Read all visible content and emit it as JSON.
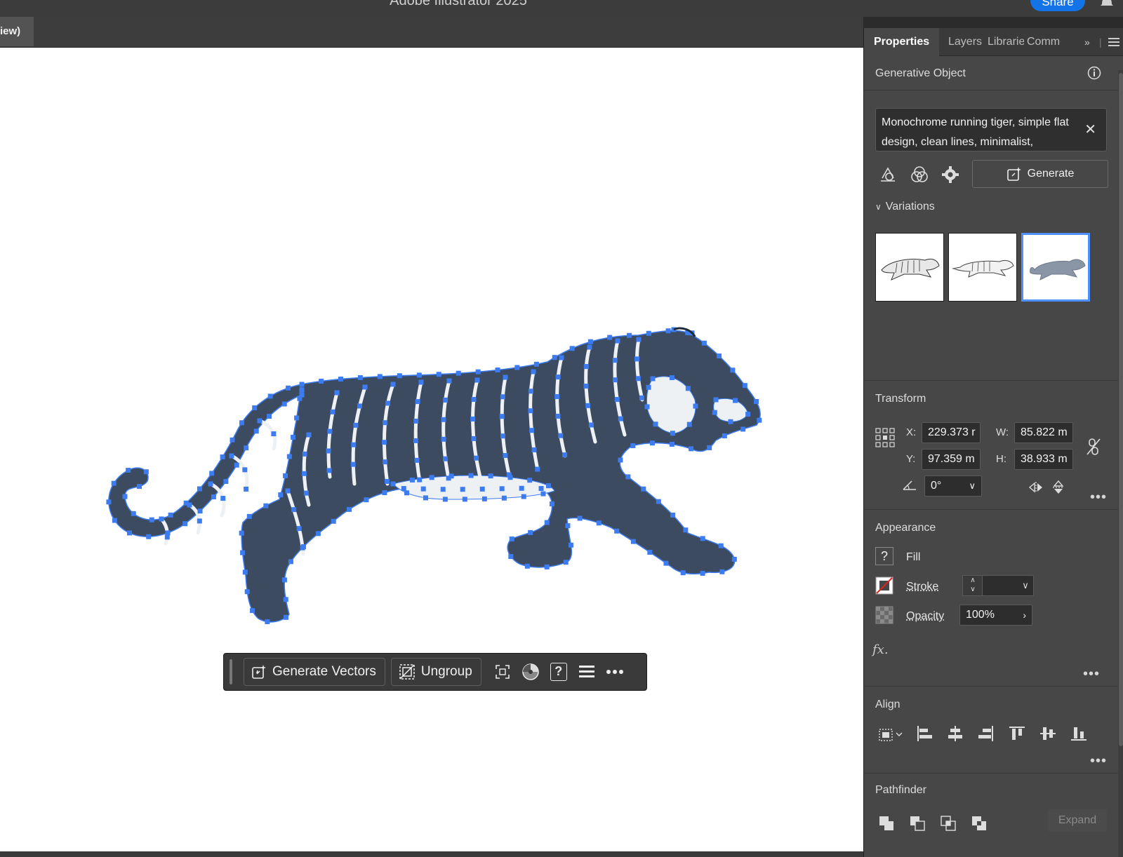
{
  "window": {
    "title": "Adobe Illustrator 2025",
    "share_label": "Share"
  },
  "document": {
    "tab_label": "iew)"
  },
  "taskbar": {
    "generate_vectors_label": "Generate Vectors",
    "ungroup_label": "Ungroup",
    "help_label": "?"
  },
  "panel": {
    "tabs": [
      "Properties",
      "Layers",
      "Libraries",
      "Comments"
    ],
    "generative_object_title": "Generative Object",
    "prompt_text": "Monochrome running tiger, simple flat design, clean lines, minimalist,",
    "generate_label": "Generate",
    "variations_label": "Variations",
    "transform": {
      "title": "Transform",
      "x_label": "X:",
      "x_value": "229.373 r",
      "y_label": "Y:",
      "y_value": "97.359 m",
      "w_label": "W:",
      "w_value": "85.822 m",
      "h_label": "H:",
      "h_value": "38.933 m",
      "angle_value": "0°"
    },
    "appearance": {
      "title": "Appearance",
      "fill_label": "Fill",
      "stroke_label": "Stroke",
      "opacity_label": "Opacity",
      "opacity_value": "100%",
      "fx_label": "fx."
    },
    "align": {
      "title": "Align"
    },
    "pathfinder": {
      "title": "Pathfinder",
      "expand_label": "Expand"
    }
  },
  "colors": {
    "selection": "#3d7cf0",
    "tiger_fill": "#3c4b5f",
    "tiger_light": "#eef1f4",
    "accent": "#1473e6"
  }
}
